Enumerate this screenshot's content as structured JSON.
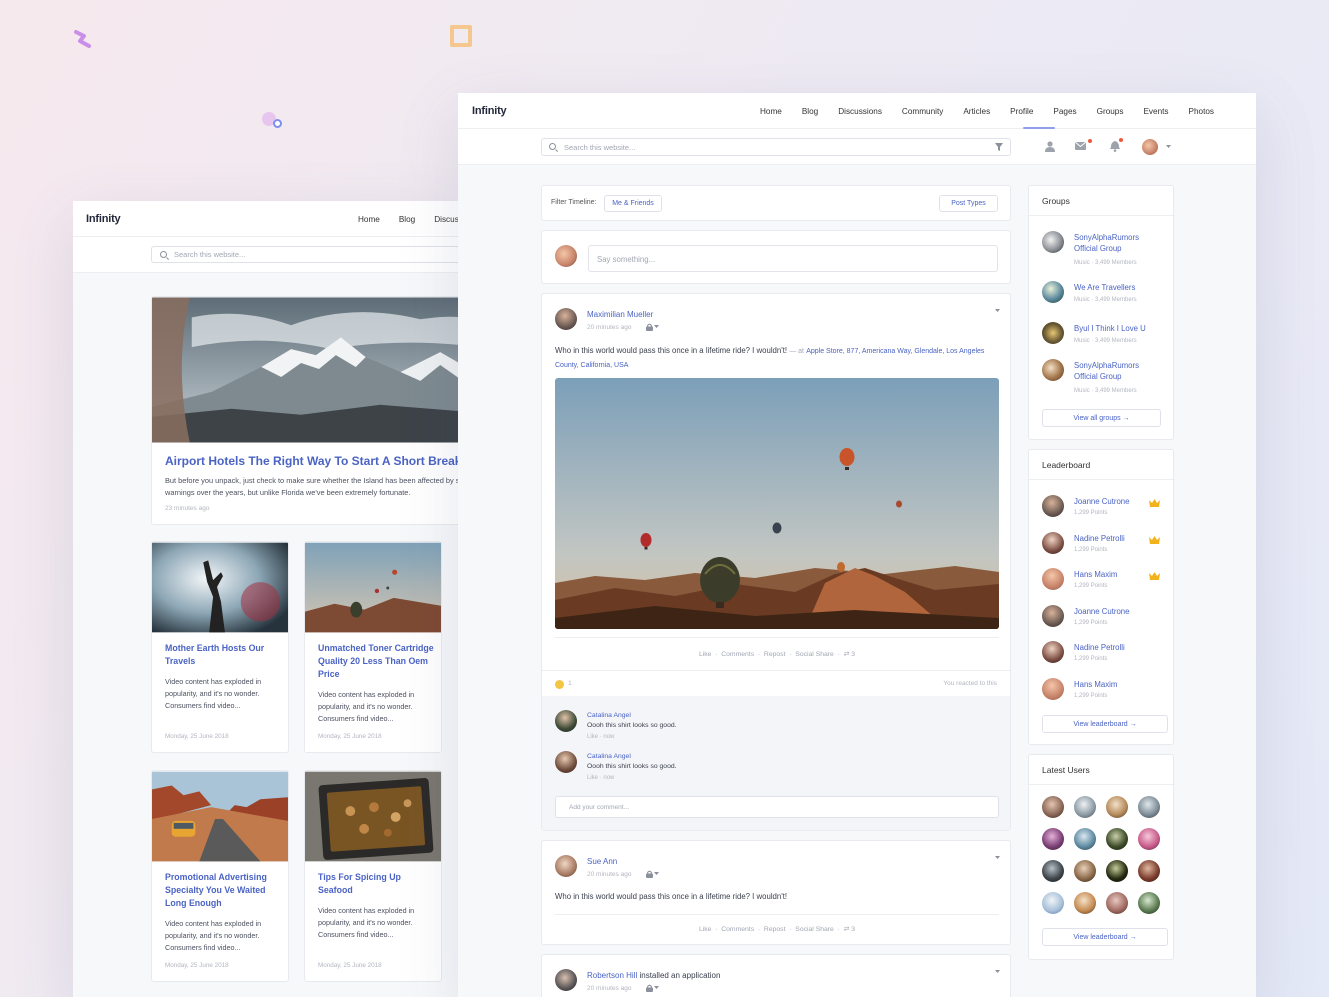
{
  "left_window": {
    "logo": "Infinity",
    "nav": [
      "Home",
      "Blog",
      "Discus"
    ],
    "search_placeholder": "Search this website...",
    "featured": {
      "title": "Airport Hotels The Right Way To Start A Short Break",
      "body": "But before you unpack, just check to make sure whether the Island has been affected by storm warnings over the years, but unlike Florida we've been extremely fortunate.",
      "time": "23 minutes ago"
    },
    "cards": [
      {
        "title": "Mother Earth Hosts Our Travels",
        "body": "Video content has exploded in popularity, and it's no wonder. Consumers find video...",
        "date": "Monday, 25 June 2018"
      },
      {
        "title": "Unmatched Toner Cartridge Quality 20 Less Than Oem Price",
        "body": "Video content has exploded in popularity, and it's no wonder. Consumers find video...",
        "date": "Monday, 25 June 2018"
      },
      {
        "title": "Promotional Advertising Specialty You Ve Waited Long Enough",
        "body": "Video content has exploded in popularity, and it's no wonder. Consumers find video...",
        "date": "Monday, 25 June 2018"
      },
      {
        "title": "Tips For Spicing Up Seafood",
        "body": "Video content has exploded in popularity, and it's no wonder. Consumers find video...",
        "date": "Monday, 25 June 2018"
      }
    ]
  },
  "right_window": {
    "logo": "Infinity",
    "nav": [
      "Home",
      "Blog",
      "Discussions",
      "Community",
      "Articles",
      "Profile",
      "Pages",
      "Groups",
      "Events",
      "Photos"
    ],
    "active_nav": "Profile",
    "search_placeholder": "Search this website...",
    "filter": {
      "label": "Filter Timeline:",
      "value": "Me & Friends",
      "post_types": "Post Types"
    },
    "composer_placeholder": "Say something...",
    "post1": {
      "author": "Maximilian Mueller",
      "time": "20 minutes ago",
      "text": "Who in this world would pass this once in a lifetime ride? I wouldn't!",
      "at": "— at",
      "location": "Apple Store, 877, Americana Way, Glendale, Los Angeles County, California, USA",
      "actions": [
        "Like",
        "Comments",
        "Repost",
        "Social Share"
      ],
      "repost_count": "3",
      "reaction_count": "1",
      "reacted_text": "You reacted to this",
      "comments": [
        {
          "author": "Catalina Angel",
          "text": "Oooh this shirt looks so good.",
          "like": "Like",
          "time": "now"
        },
        {
          "author": "Catalina Angel",
          "text": "Oooh this shirt looks so good.",
          "like": "Like",
          "time": "now"
        }
      ],
      "comment_placeholder": "Add your comment..."
    },
    "post2": {
      "author": "Sue Ann",
      "time": "20 minutes ago",
      "text": "Who in this world would pass this once in a lifetime ride? I wouldn't!",
      "actions": [
        "Like",
        "Comments",
        "Repost",
        "Social Share"
      ],
      "repost_count": "3"
    },
    "post3": {
      "author": "Robertson Hill",
      "action": "installed an application",
      "time": "20 minutes ago"
    },
    "groups": {
      "title": "Groups",
      "items": [
        {
          "name": "SonyAlphaRumors Official Group",
          "meta": "Music · 3,499 Members"
        },
        {
          "name": "We Are Travellers",
          "meta": "Music · 3,499 Members"
        },
        {
          "name": "Byul I Think I Love U",
          "meta": "Music · 3,499 Members"
        },
        {
          "name": "SonyAlphaRumors Official Group",
          "meta": "Music · 3,499 Members"
        }
      ],
      "button": "View all groups →"
    },
    "leaderboard": {
      "title": "Leaderboard",
      "items": [
        {
          "name": "Joanne Cutrone",
          "points": "1,299 Points",
          "crown": true
        },
        {
          "name": "Nadine Petrolli",
          "points": "1,299 Points",
          "crown": true
        },
        {
          "name": "Hans Maxim",
          "points": "1,299 Points",
          "crown": true
        },
        {
          "name": "Joanne Cutrone",
          "points": "1,299 Points",
          "crown": false
        },
        {
          "name": "Nadine Petrolli",
          "points": "1,299 Points",
          "crown": false
        },
        {
          "name": "Hans Maxim",
          "points": "1,299 Points",
          "crown": false
        }
      ],
      "button": "View leaderboard →"
    },
    "latest_users": {
      "title": "Latest Users",
      "button": "View leaderboard →"
    }
  },
  "colors": {
    "accent": "#4a63c4",
    "crown": "#f2b21b",
    "notification": "#ef5a3c"
  }
}
